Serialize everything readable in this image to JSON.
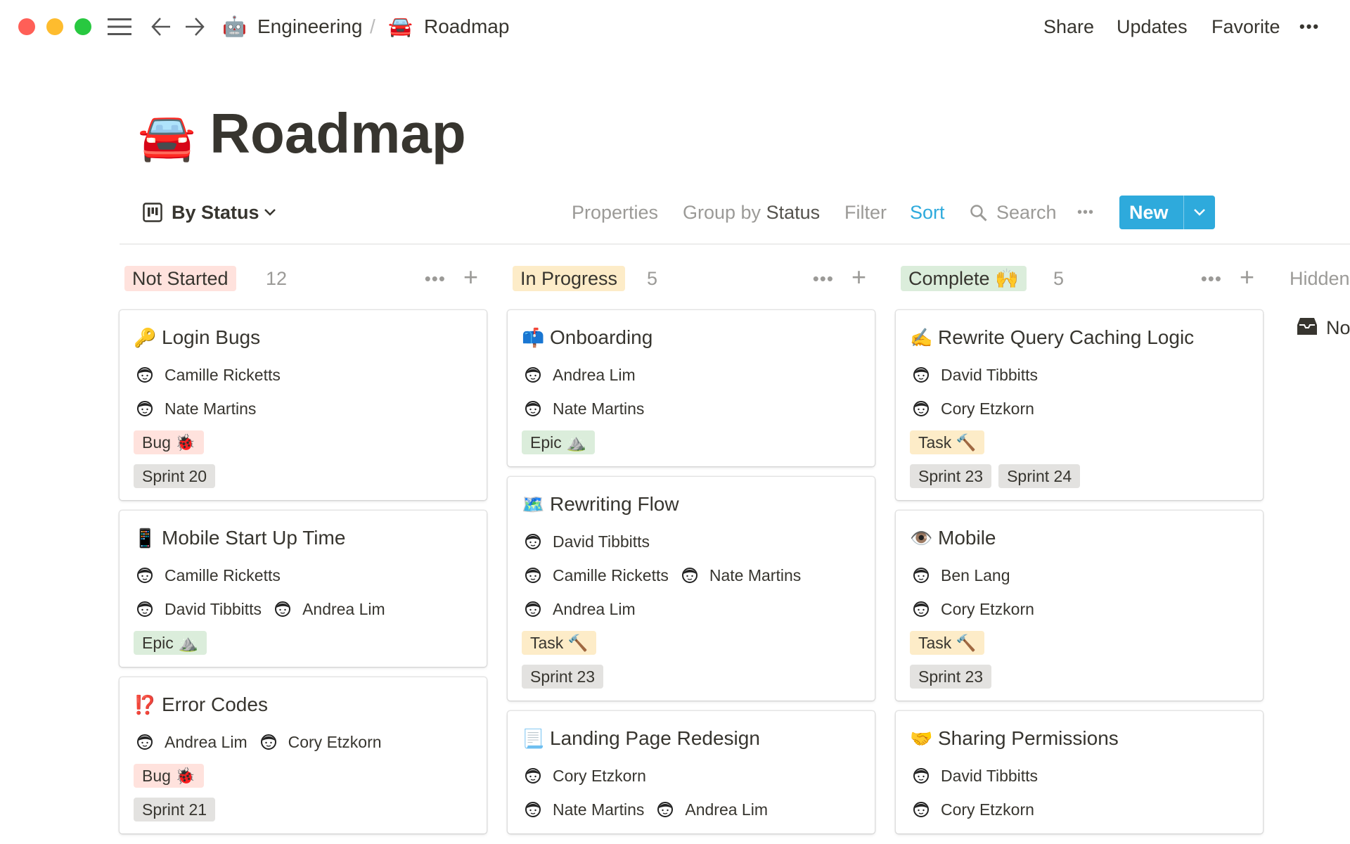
{
  "colors": {
    "accent": "#2eaadc",
    "not_started": "#ffe2dd",
    "in_progress": "#fdecc8",
    "complete": "#dbeddb",
    "bug": "#ffe2dd",
    "task": "#fdecc8",
    "epic": "#dbeddb",
    "sprint": "#e3e2e0"
  },
  "topbar": {
    "breadcrumb": [
      {
        "icon": "🤖",
        "label": "Engineering"
      },
      {
        "icon": "🚘",
        "label": "Roadmap"
      }
    ],
    "separator": "/",
    "actions": [
      "Share",
      "Updates",
      "Favorite"
    ],
    "more": "•••"
  },
  "page": {
    "icon": "🚘",
    "title": "Roadmap"
  },
  "toolbar": {
    "view": "By Status",
    "properties": "Properties",
    "group_by": "Group by",
    "group_value": "Status",
    "filter": "Filter",
    "sort": "Sort",
    "search": "Search",
    "more": "•••",
    "new": "New"
  },
  "columns": [
    {
      "name": "Not Started",
      "count": "12",
      "color": "#ffe2dd",
      "cards": [
        {
          "icon": "🔑",
          "title": "Login Bugs",
          "rows": [
            [
              "Camille Ricketts"
            ],
            [
              "Nate Martins"
            ]
          ],
          "tags": [
            {
              "label": "Bug 🐞",
              "type": "bug"
            }
          ],
          "sprints": [
            "Sprint 20"
          ]
        },
        {
          "icon": "📱",
          "title": "Mobile Start Up Time",
          "rows": [
            [
              "Camille Ricketts"
            ],
            [
              "David Tibbitts",
              "Andrea Lim"
            ]
          ],
          "tags": [
            {
              "label": "Epic ⛰️",
              "type": "epic"
            }
          ],
          "sprints": []
        },
        {
          "icon": "⁉️",
          "title": "Error Codes",
          "rows": [
            [
              "Andrea Lim",
              "Cory Etzkorn"
            ]
          ],
          "tags": [
            {
              "label": "Bug 🐞",
              "type": "bug"
            }
          ],
          "sprints": [
            "Sprint 21"
          ]
        }
      ]
    },
    {
      "name": "In Progress",
      "count": "5",
      "color": "#fdecc8",
      "cards": [
        {
          "icon": "📫",
          "title": "Onboarding",
          "rows": [
            [
              "Andrea Lim"
            ],
            [
              "Nate Martins"
            ]
          ],
          "tags": [
            {
              "label": "Epic ⛰️",
              "type": "epic"
            }
          ],
          "sprints": []
        },
        {
          "icon": "🗺️",
          "title": "Rewriting Flow",
          "rows": [
            [
              "David Tibbitts"
            ],
            [
              "Camille Ricketts",
              "Nate Martins"
            ],
            [
              "Andrea Lim"
            ]
          ],
          "tags": [
            {
              "label": "Task 🔨",
              "type": "task"
            }
          ],
          "sprints": [
            "Sprint 23"
          ]
        },
        {
          "icon": "📃",
          "title": "Landing Page Redesign",
          "rows": [
            [
              "Cory Etzkorn"
            ],
            [
              "Nate Martins",
              "Andrea Lim"
            ]
          ],
          "tags": [],
          "sprints": []
        }
      ]
    },
    {
      "name": "Complete 🙌",
      "count": "5",
      "color": "#dbeddb",
      "cards": [
        {
          "icon": "✍️",
          "title": "Rewrite Query Caching Logic",
          "rows": [
            [
              "David Tibbitts"
            ],
            [
              "Cory Etzkorn"
            ]
          ],
          "tags": [
            {
              "label": "Task 🔨",
              "type": "task"
            }
          ],
          "sprints": [
            "Sprint 23",
            "Sprint 24"
          ]
        },
        {
          "icon": "👁️",
          "title": "Mobile",
          "rows": [
            [
              "Ben Lang"
            ],
            [
              "Cory Etzkorn"
            ]
          ],
          "tags": [
            {
              "label": "Task 🔨",
              "type": "task"
            }
          ],
          "sprints": [
            "Sprint 23"
          ]
        },
        {
          "icon": "🤝",
          "title": "Sharing Permissions",
          "rows": [
            [
              "David Tibbitts"
            ],
            [
              "Cory Etzkorn"
            ]
          ],
          "tags": [],
          "sprints": []
        }
      ]
    }
  ],
  "hidden": {
    "label": "Hidden",
    "item": "No Status",
    "item_icon": "inbox-icon"
  }
}
